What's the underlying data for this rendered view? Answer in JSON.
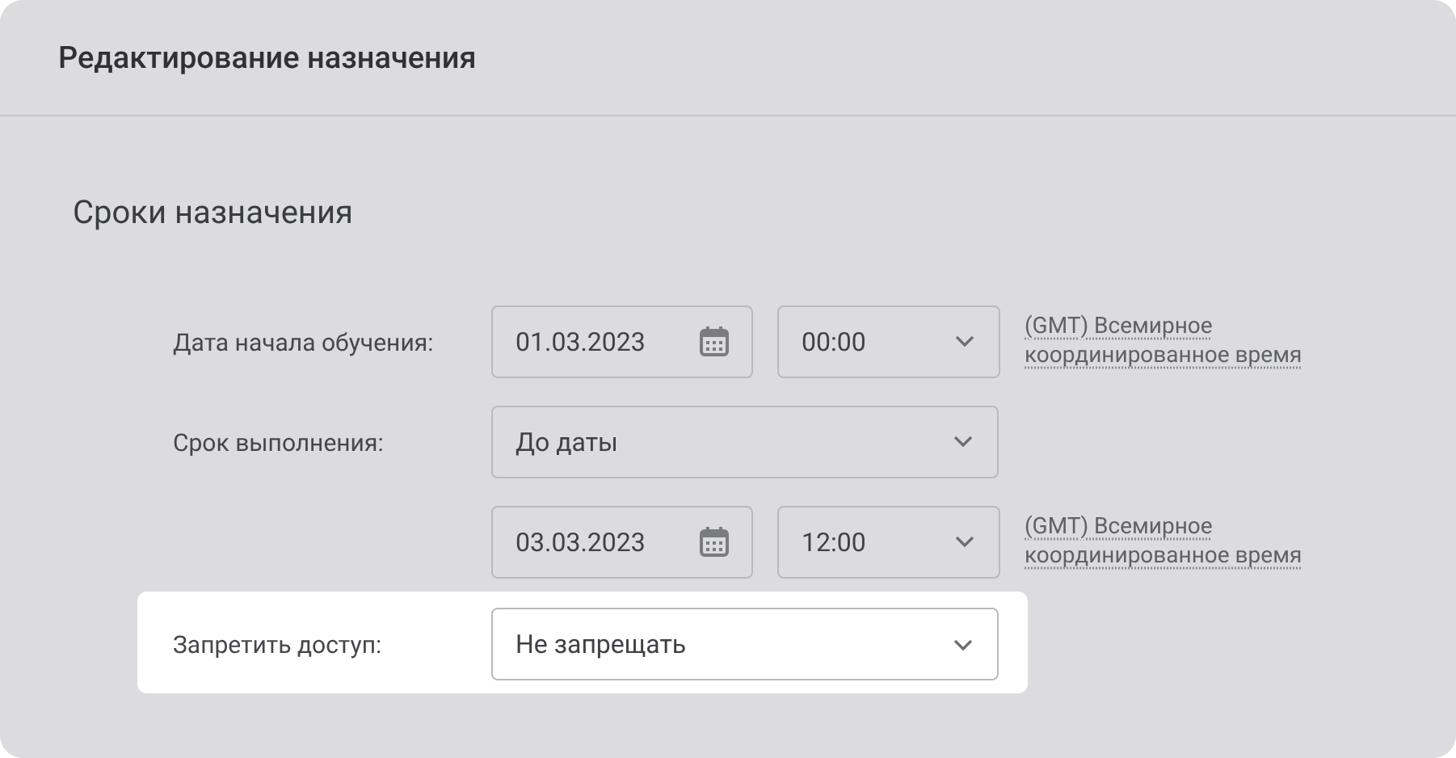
{
  "header": {
    "title": "Редактирование назначения"
  },
  "section": {
    "title": "Сроки назначения"
  },
  "rows": [
    {
      "kind": "datetime",
      "label": "Дата начала обучения:",
      "date": "01.03.2023",
      "time": "00:00",
      "timezone": "(GMT) Всемирное координированное время",
      "highlighted": false
    },
    {
      "kind": "select",
      "label": "Срок выполнения:",
      "value": "До даты",
      "highlighted": false
    },
    {
      "kind": "datetime",
      "date": "03.03.2023",
      "time": "12:00",
      "timezone": "(GMT) Всемирное координированное время",
      "highlighted": false
    },
    {
      "kind": "select",
      "label": "Запретить доступ:",
      "value": "Не запрещать",
      "highlighted": true
    }
  ]
}
